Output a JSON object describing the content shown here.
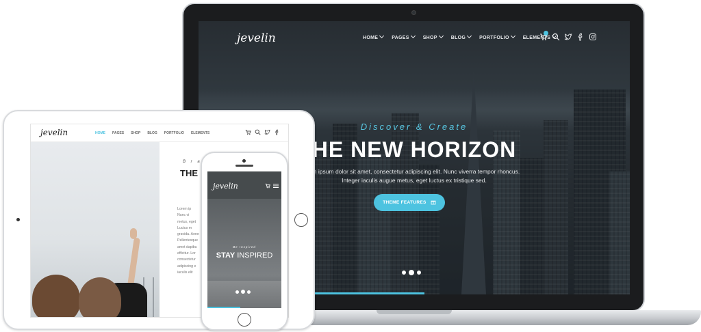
{
  "brand": {
    "accent": "#4dc3e0"
  },
  "laptop": {
    "logo": "jevelin",
    "menu": [
      "HOME",
      "PAGES",
      "SHOP",
      "BLOG",
      "PORTFOLIO",
      "ELEMENTS"
    ],
    "hero": {
      "kicker": "Discover & Create",
      "title": "HE NEW HORIZON",
      "sub_line1": "em ipsum dolor sit amet, consectetur adipiscing elit. Nunc viverra tempor rhoncus.",
      "sub_line2": "Integer iaculis augue metus, eget luctus ex tristique sed.",
      "button": "THEME FEATURES"
    }
  },
  "tablet": {
    "logo": "jevelin",
    "menu": [
      "HOME",
      "PAGES",
      "SHOP",
      "BLOG",
      "PORTFOLIO",
      "ELEMENTS"
    ],
    "kicker": "B r a n",
    "title": "THE S",
    "para": [
      "Lorem ip",
      "Nunc vi",
      "metus, eget",
      "Luctus m",
      "gravida. Aene",
      "Pellentesque",
      "amet dapibu",
      "efficitur. Lor",
      "consectetur",
      "adipiscing e",
      "iaculis elit"
    ]
  },
  "phone": {
    "logo": "jevelin",
    "kicker": "Be Inspired",
    "title_bold": "STAY",
    "title_rest": " INSPIRED"
  }
}
